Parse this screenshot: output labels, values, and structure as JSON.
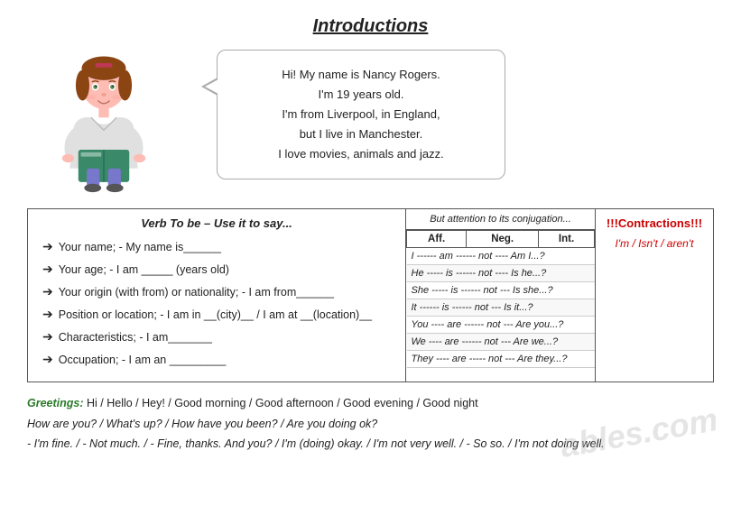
{
  "page": {
    "title": "Introductions"
  },
  "speech_bubble": {
    "line1": "Hi! My name is Nancy Rogers.",
    "line2": "I'm 19 years old.",
    "line3": "I'm from Liverpool, in England,",
    "line4": "but I live in Manchester.",
    "line5": "I love movies, animals and jazz."
  },
  "verb_panel": {
    "title": "Verb To be – Use it to say...",
    "items": [
      "Your name; - My name is______",
      "Your age; - I am _____ (years old)",
      "Your origin (with from) or nationality; - I am from______",
      "Position or location; - I am in __(city)__ / I am at __(location)__",
      "Characteristics; - I am_______",
      "Occupation; - I am an _________"
    ]
  },
  "conj_panel": {
    "header": "But attention to its conjugation...",
    "columns": [
      "Aff.",
      "Neg.",
      "Int."
    ],
    "rows": [
      "I ------ am ------ not ---- Am I...?",
      "He ----- is ------ not ---- Is he...?",
      "She ----- is ------ not --- Is she...?",
      "It ------ is ------ not --- Is it...?",
      "You ---- are ------ not --- Are you...?",
      "We ---- are ------ not --- Are we...?",
      "They ---- are ----- not --- Are they...?"
    ],
    "rows_structured": [
      {
        "subj": "I",
        "aff": "am",
        "neg": "not",
        "int": "Am I...?"
      },
      {
        "subj": "He",
        "aff": "is",
        "neg": "not",
        "int": "Is he...?"
      },
      {
        "subj": "She",
        "aff": "is",
        "neg": "not",
        "int": "Is she...?"
      },
      {
        "subj": "It",
        "aff": "is",
        "neg": "not",
        "int": "Is it...?"
      },
      {
        "subj": "You",
        "aff": "are",
        "neg": "not",
        "int": "Are you...?"
      },
      {
        "subj": "We",
        "aff": "are",
        "neg": "not",
        "int": "Are we...?"
      },
      {
        "subj": "They",
        "aff": "are",
        "neg": "not",
        "int": "Are they...?"
      }
    ]
  },
  "contractions": {
    "title": "!!!Contractions!!!",
    "text": "I'm / Isn't / aren't"
  },
  "greetings": {
    "label": "Greetings:",
    "line1": " Hi / Hello / Hey! / Good morning / Good afternoon / Good evening / Good night",
    "line2": "How are you? / What's up? / How have you been? / Are you doing ok?",
    "line3": "- I'm fine. / - Not much. / - Fine, thanks. And you? / I'm (doing) okay. / I'm not very well. / - So so. / I'm not doing well."
  },
  "watermark": "ables.com"
}
